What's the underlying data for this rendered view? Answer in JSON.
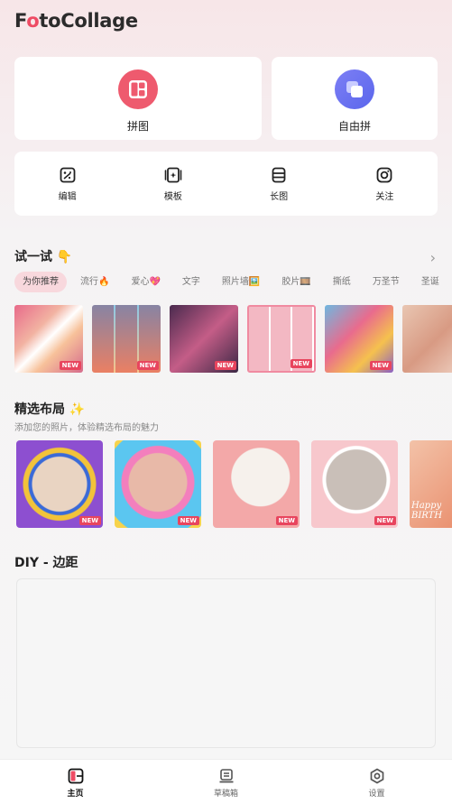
{
  "app": {
    "logo_text_a": "F",
    "logo_text_b": "o",
    "logo_text_c": "toCollage"
  },
  "main_cards": {
    "collage_label": "拼图",
    "freestyle_label": "自由拼"
  },
  "tools": [
    {
      "label": "编辑",
      "icon": "magic-edit-icon"
    },
    {
      "label": "模板",
      "icon": "template-icon"
    },
    {
      "label": "长图",
      "icon": "long-image-icon"
    },
    {
      "label": "关注",
      "icon": "instagram-icon"
    }
  ],
  "try_section": {
    "title": "试一试 👇",
    "chips": [
      "为你推荐",
      "流行🔥",
      "爱心💖",
      "文字",
      "照片墙🖼️",
      "胶片🎞️",
      "撕纸",
      "万圣节",
      "圣诞"
    ],
    "active_chip": "为你推荐",
    "badge": "NEW"
  },
  "featured": {
    "title": "精选布局 ✨",
    "subtitle": "添加您的照片，体验精选布局的魅力",
    "badge": "NEW",
    "last_card_text": "Happy BIRTH"
  },
  "diy": {
    "title": "DIY - 边距"
  },
  "tabbar": {
    "home": "主页",
    "drafts": "草稿箱",
    "settings": "设置"
  },
  "colors": {
    "accent": "#ee4b64",
    "chip_active": "#f8d8dd",
    "purple": "#6f74f0"
  }
}
